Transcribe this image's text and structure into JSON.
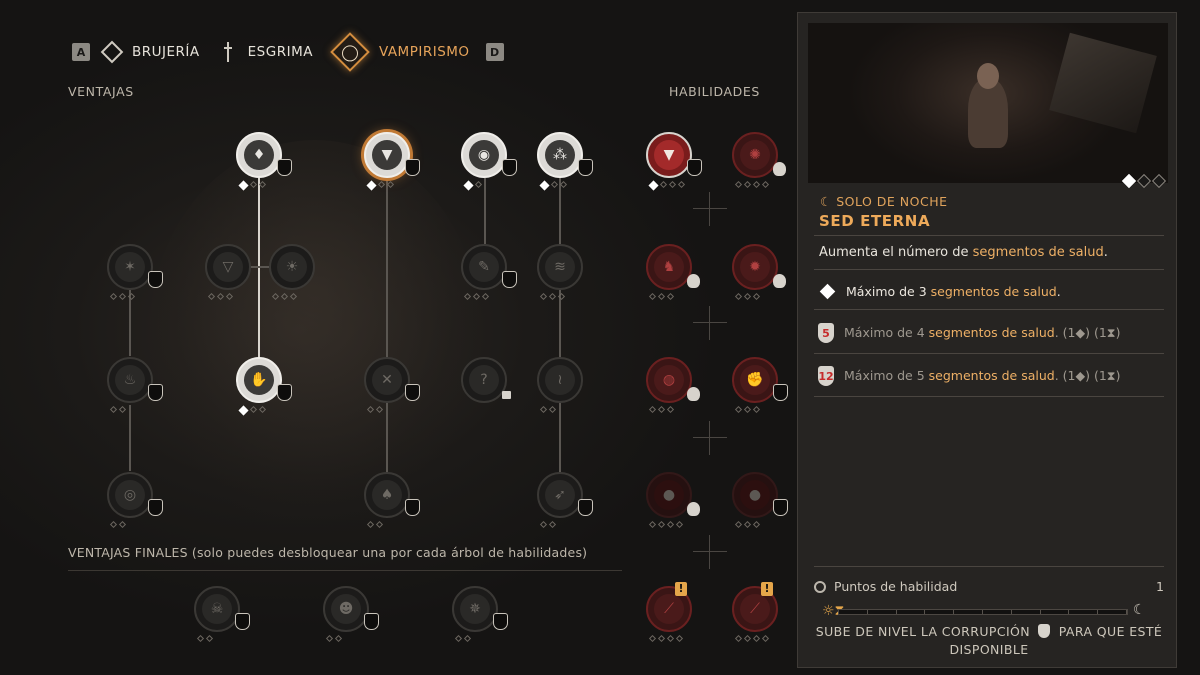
{
  "tabs": {
    "left_key": "A",
    "right_key": "D",
    "items": [
      {
        "label": "BRUJERÍA",
        "icon": "witchcraft-icon"
      },
      {
        "label": "ESGRIMA",
        "icon": "sword-icon"
      },
      {
        "label": "VAMPIRISMO",
        "icon": "vampire-fangs-icon",
        "active": true
      }
    ]
  },
  "sections": {
    "perks": "VENTAJAS",
    "abilities": "HABILIDADES",
    "final_perks": "VENTAJAS FINALES (solo puedes desbloquear una por cada árbol de habilidades)"
  },
  "locked_node_symbol": "?",
  "abilities_alerts": [
    "!",
    "!"
  ],
  "panel": {
    "tag_icon": "☾",
    "tag": "SOLO DE NOCHE",
    "title": "SED ETERNA",
    "desc_prefix": "Aumenta el número de ",
    "desc_highlight": "segmentos de salud",
    "desc_suffix": ".",
    "tiers": [
      {
        "icon": "white-diamond",
        "prefix": "Máximo de 3 ",
        "highlight": "segmentos de salud",
        "suffix": ".",
        "cost": "",
        "unlocked": true
      },
      {
        "icon": "corruption-cup",
        "level": "5",
        "prefix": "Máximo de 4 ",
        "highlight": "segmentos de salud",
        "suffix": ".",
        "cost": "(1◆) (1⧗)",
        "unlocked": false
      },
      {
        "icon": "corruption-cup",
        "level": "12",
        "prefix": "Máximo de 5 ",
        "highlight": "segmentos de salud",
        "suffix": ".",
        "cost": "(1◆) (1⧗)",
        "unlocked": false
      }
    ],
    "skill_points_label": "Puntos de habilidad",
    "skill_points_value": "1",
    "sun_icon": "☼⧗",
    "moon_icon": "☾",
    "level_msg_1": "SUBE DE NIVEL LA CORRUPCIÓN",
    "level_msg_2": "PARA QUE ESTÉ",
    "level_msg_3": "DISPONIBLE"
  },
  "colors": {
    "accent": "#e5a35a",
    "highlight": "#eeb066",
    "blood": "#7a1c1c"
  }
}
